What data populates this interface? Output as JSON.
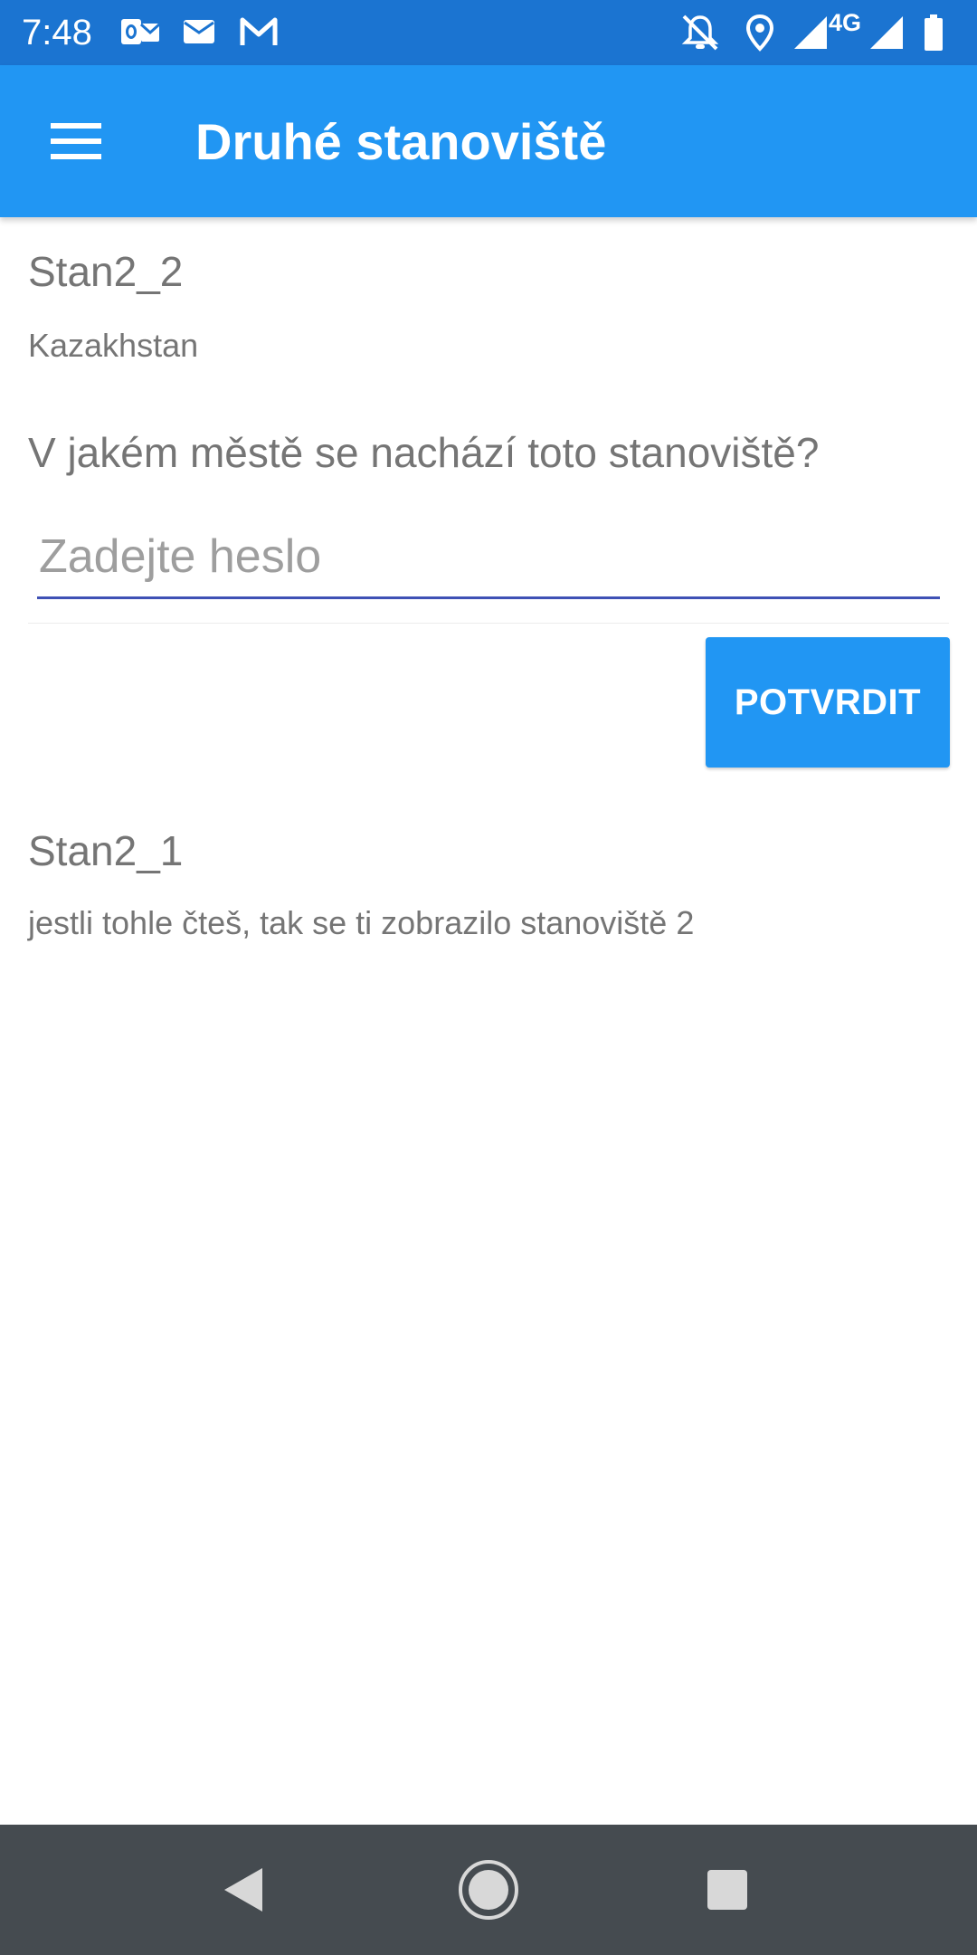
{
  "status_bar": {
    "time": "7:48",
    "network_label": "4G",
    "left_icons": [
      "outlook-icon",
      "mail-icon",
      "gmail-icon"
    ],
    "right_icons": [
      "notifications-off-icon",
      "location-icon",
      "signal-icon",
      "battery-icon"
    ]
  },
  "app_bar": {
    "title": "Druhé stanoviště",
    "menu_icon": "hamburger-menu-icon",
    "background": "#2196f3"
  },
  "station_current": {
    "title": "Stan2_2",
    "subtitle": "Kazakhstan",
    "question": "V jakém městě se nachází toto stanoviště?",
    "password_placeholder": "Zadejte heslo",
    "password_value": "",
    "confirm_label": "POTVRDIT"
  },
  "station_previous": {
    "title": "Stan2_1",
    "text": "jestli tohle čteš, tak se ti zobrazilo stanoviště 2"
  },
  "nav_bar": {
    "buttons": [
      "back-icon",
      "home-icon",
      "recents-icon"
    ]
  },
  "colors": {
    "status_bar": "#1b74d1",
    "accent": "#2196f3",
    "text_secondary": "#757575",
    "input_underline": "#3f51b5",
    "nav_bar": "#454b50"
  }
}
